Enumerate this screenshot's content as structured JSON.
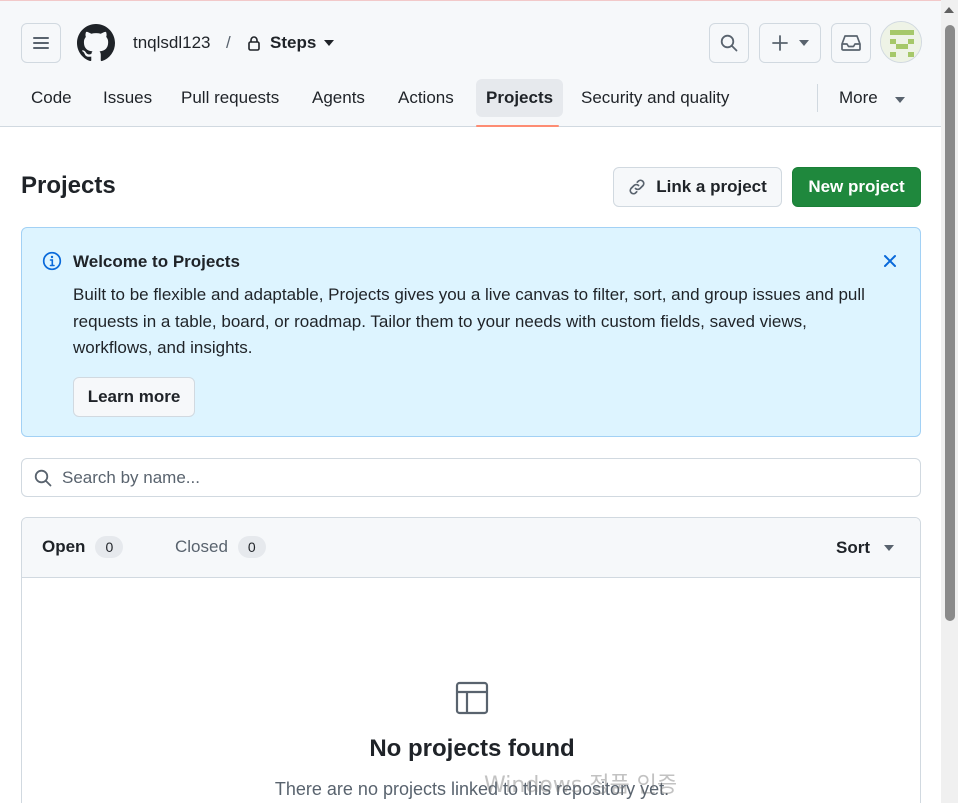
{
  "header": {
    "owner": "tnqlsdl123",
    "separator": "/",
    "repo": "Steps"
  },
  "tabs": [
    {
      "label": "Code"
    },
    {
      "label": "Issues"
    },
    {
      "label": "Pull requests"
    },
    {
      "label": "Agents"
    },
    {
      "label": "Actions"
    },
    {
      "label": "Projects",
      "active": true
    },
    {
      "label": "Security and quality"
    },
    {
      "label": "More"
    }
  ],
  "page": {
    "title": "Projects",
    "link_button": "Link a project",
    "new_button": "New project"
  },
  "banner": {
    "title": "Welcome to Projects",
    "body": "Built to be flexible and adaptable, Projects gives you a live canvas to filter, sort, and group issues and pull requests in a table, board, or roadmap. Tailor them to your needs with custom fields, saved views, workflows, and insights.",
    "learn_more": "Learn more"
  },
  "search": {
    "placeholder": "Search by name..."
  },
  "list": {
    "open_label": "Open",
    "open_count": "0",
    "closed_label": "Closed",
    "closed_count": "0",
    "sort_label": "Sort",
    "empty_title": "No projects found",
    "empty_text": "There are no projects linked to this repository yet."
  },
  "watermark": "Windows 정품 인증",
  "colors": {
    "primary_green": "#1f883d",
    "banner_bg": "#ddf4ff",
    "active_tab_underline": "#fd8c73",
    "info_blue": "#0969da"
  }
}
